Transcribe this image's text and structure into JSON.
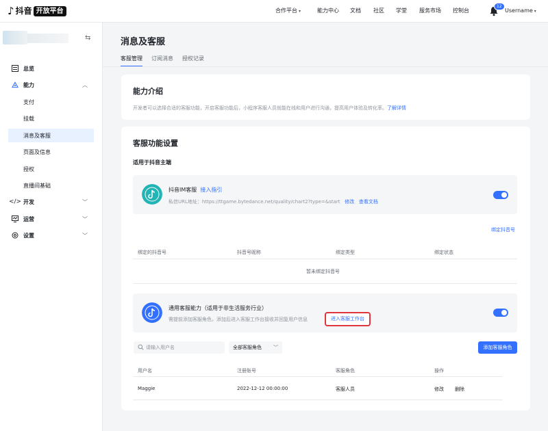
{
  "topbar": {
    "logo_glyph": "♪",
    "logo_name": "抖音",
    "logo_badge": "开放平台",
    "nav": [
      "合作平台",
      "能力中心",
      "文档",
      "社区",
      "学堂",
      "服务市场",
      "控制台"
    ],
    "notification_count": "12",
    "username": "Username",
    "caret": "▾"
  },
  "sidebar": {
    "collapse_icon": "⇆",
    "items": {
      "overview": "总览",
      "ability": "能力",
      "develop": "开发",
      "operate": "运营",
      "settings": "设置"
    },
    "sub_items": [
      "支付",
      "挂载",
      "消息及客服",
      "页面及信息",
      "授权",
      "直播间基础"
    ],
    "chevron_up": "︿",
    "chevron_down": "﹀"
  },
  "page": {
    "title": "消息及客服",
    "tabs": [
      "客服管理",
      "订阅消息",
      "授权记录"
    ]
  },
  "intro": {
    "title": "能力介绍",
    "desc": "开发者可以选择合适的客服功能，开启客服功能后，小程序客服人员就能在线和用户进行沟通，提高用户体验及转化率。",
    "link": "了解详情"
  },
  "settings_card": {
    "title": "客服功能设置",
    "subtitle": "适用于抖音主端",
    "im": {
      "name": "抖音IM客服",
      "guide_link": "接入指引",
      "url_text": "私信URL地址：https://ttgame.bytedance.net/quality/chart2?type=&start",
      "edit": "修改",
      "docs": "查看文档"
    },
    "bind_link": "绑定抖音号",
    "bind_table": {
      "headers": [
        "绑定的抖音号",
        "抖音号昵称",
        "绑定类型",
        "绑定状态"
      ],
      "empty": "暂未绑定抖音号"
    },
    "general": {
      "name": "通用客服能力（适用于非生活服务行业）",
      "desc": "需提前添加客服角色，添加后进入客服工作台接收并回复用户信息",
      "enter_button": "进入客服工作台"
    },
    "filters": {
      "search_placeholder": "请输入用户名",
      "role_select": "全部客服角色",
      "add_button": "添加客服角色"
    },
    "staff_table": {
      "headers": [
        "用户名",
        "注册账号",
        "客服角色",
        "操作"
      ],
      "rows": [
        {
          "username": "Maggie",
          "account": "2022-12-12 00:00:00",
          "role": "客服人员",
          "edit": "修改",
          "delete": "删除"
        }
      ]
    }
  },
  "colors": {
    "accent": "#3370ff",
    "highlight": "#e0353a"
  }
}
